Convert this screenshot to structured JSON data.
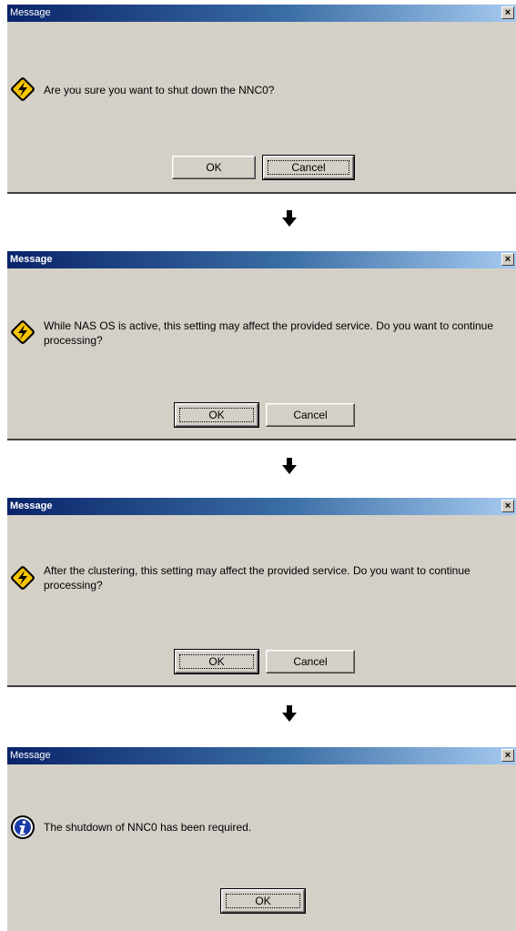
{
  "dialogs": [
    {
      "title": "Message",
      "close": "×",
      "icon": "warning-lightning-icon",
      "message": "Are you sure you want to shut down the NNC0?",
      "buttons": [
        "OK",
        "Cancel"
      ]
    },
    {
      "title": "Message",
      "close": "×",
      "icon": "warning-lightning-icon",
      "message": "While NAS OS is active, this setting may affect the provided service. Do you want to continue processing?",
      "buttons": [
        "OK",
        "Cancel"
      ]
    },
    {
      "title": "Message",
      "close": "×",
      "icon": "warning-lightning-icon",
      "message": "After the clustering, this setting may affect the provided service. Do you want to continue processing?",
      "buttons": [
        "OK",
        "Cancel"
      ]
    },
    {
      "title": "Message",
      "close": "×",
      "icon": "info-icon",
      "message": "The shutdown of NNC0 has been required.",
      "buttons": [
        "OK"
      ]
    }
  ],
  "flow_arrow_icon": "arrow-down-icon"
}
